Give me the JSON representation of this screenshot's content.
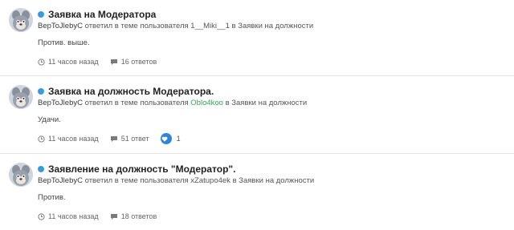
{
  "posts": [
    {
      "title": "Заявка на Модератора",
      "author": "BepToJlebyC",
      "action_text": "ответил в теме пользователя",
      "reply_user": "1__Miki__1",
      "reply_user_highlight": false,
      "in_text": "в",
      "forum": "Заявки на должности",
      "snippet": "Против. выше.",
      "time": "11 часов назад",
      "replies": "16 ответов",
      "likes": ""
    },
    {
      "title": "Заявка на должность Модератора.",
      "author": "BepToJlebyC",
      "action_text": "ответил в теме пользователя",
      "reply_user": "Oblo4koo",
      "reply_user_highlight": true,
      "in_text": "в",
      "forum": "Заявки на должности",
      "snippet": "Удачи.",
      "time": "11 часов назад",
      "replies": "51 ответ",
      "likes": "1"
    },
    {
      "title": "Заявление на должность \"Модератор\".",
      "author": "BepToJlebyC",
      "action_text": "ответил в теме пользователя",
      "reply_user": "xZatupo4ek",
      "reply_user_highlight": false,
      "in_text": "в",
      "forum": "Заявки на должности",
      "snippet": "Против.",
      "time": "11 часов назад",
      "replies": "18 ответов",
      "likes": ""
    }
  ],
  "colors": {
    "unread_dot": "#3b9ad9",
    "highlight_user": "#2fa84f",
    "like_badge": "#2f85d8"
  },
  "icons": {
    "time": "clock-icon",
    "replies": "comment-icon",
    "like": "heart-icon"
  }
}
